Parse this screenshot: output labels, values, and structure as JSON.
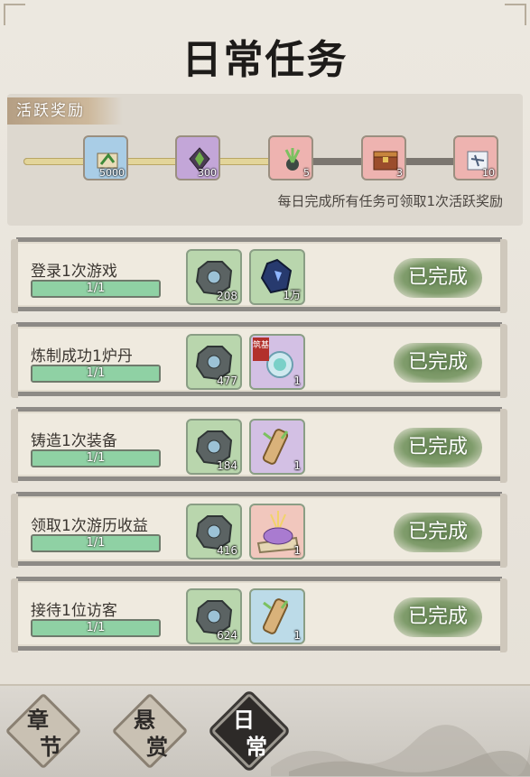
{
  "title": "日常任务",
  "activity": {
    "tag": "活跃奖励",
    "note": "每日完成所有任务可领取1次活跃奖励",
    "progress": 0.55,
    "milestones": [
      {
        "count": "5000",
        "icon": "scroll-icon",
        "color": "#a9cde6"
      },
      {
        "count": "300",
        "icon": "crystal-icon",
        "color": "#c3a6d8"
      },
      {
        "count": "5",
        "icon": "herb-icon",
        "color": "#eeb3b0"
      },
      {
        "count": "3",
        "icon": "treasure-chest-icon",
        "color": "#eeb3b0"
      },
      {
        "count": "10",
        "icon": "puzzle-map-icon",
        "color": "#eeb3b0"
      }
    ]
  },
  "tasks": [
    {
      "name": "登录1次游戏",
      "progress": "1/1",
      "fraction": 1.0,
      "status": "已完成",
      "rewards": [
        {
          "icon": "spirit-stone-icon",
          "qty": "208"
        },
        {
          "icon": "blue-gem-icon",
          "qty": "1万",
          "bg": "#b9d6ad"
        }
      ]
    },
    {
      "name": "炼制成功1炉丹",
      "progress": "1/1",
      "fraction": 1.0,
      "status": "已完成",
      "rewards": [
        {
          "icon": "spirit-stone-icon",
          "qty": "477"
        },
        {
          "icon": "pill-orb-icon",
          "qty": "1",
          "bg": "#d3c0e4",
          "tag": "筑基"
        }
      ]
    },
    {
      "name": "铸造1次装备",
      "progress": "1/1",
      "fraction": 1.0,
      "status": "已完成",
      "rewards": [
        {
          "icon": "spirit-stone-icon",
          "qty": "184"
        },
        {
          "icon": "scroll-icon",
          "qty": "1",
          "bg": "#d3c0e4"
        }
      ]
    },
    {
      "name": "领取1次游历收益",
      "progress": "1/1",
      "fraction": 1.0,
      "status": "已完成",
      "rewards": [
        {
          "icon": "spirit-stone-icon",
          "qty": "416"
        },
        {
          "icon": "treasure-pile-icon",
          "qty": "1",
          "bg": "#f1c7bd"
        }
      ]
    },
    {
      "name": "接待1位访客",
      "progress": "1/1",
      "fraction": 1.0,
      "status": "已完成",
      "rewards": [
        {
          "icon": "spirit-stone-icon",
          "qty": "624"
        },
        {
          "icon": "scroll-icon",
          "qty": "1",
          "bg": "#bcdbe8"
        }
      ]
    }
  ],
  "tabs": [
    {
      "c1": "章",
      "c2": "节",
      "active": false
    },
    {
      "c1": "悬",
      "c2": "赏",
      "active": false
    },
    {
      "c1": "日",
      "c2": "常",
      "active": true
    }
  ]
}
